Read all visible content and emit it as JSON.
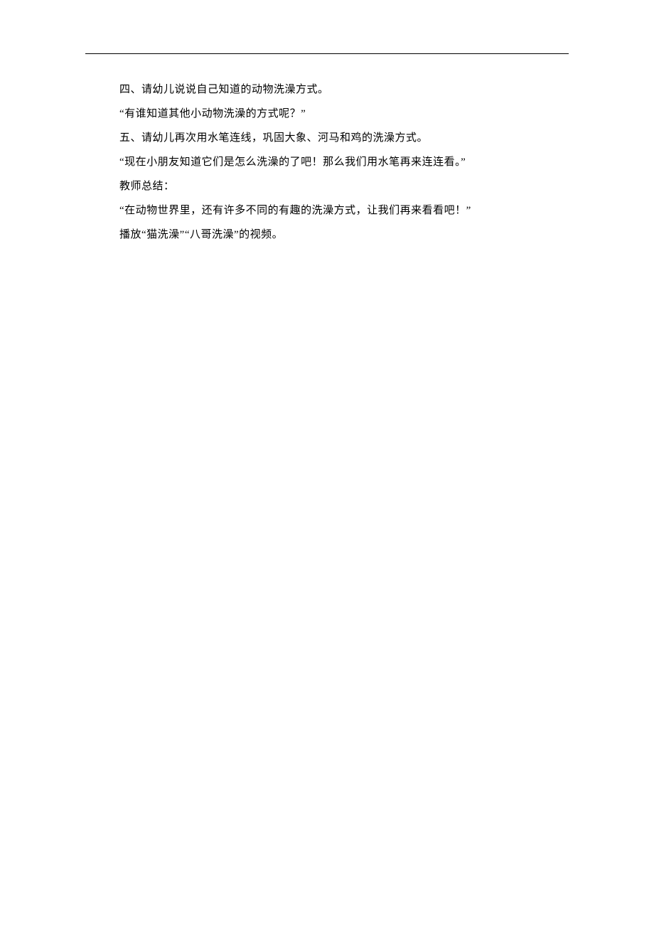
{
  "lines": [
    "四、请幼儿说说自己知道的动物洗澡方式。",
    "“有谁知道其他小动物洗澡的方式呢？”",
    "五、请幼儿再次用水笔连线，巩固大象、河马和鸡的洗澡方式。",
    "“现在小朋友知道它们是怎么洗澡的了吧！那么我们用水笔再来连连看。”",
    "教师总结：",
    "“在动物世界里，还有许多不同的有趣的洗澡方式，让我们再来看看吧！”",
    "播放“猫洗澡”“八哥洗澡”的视频。"
  ]
}
